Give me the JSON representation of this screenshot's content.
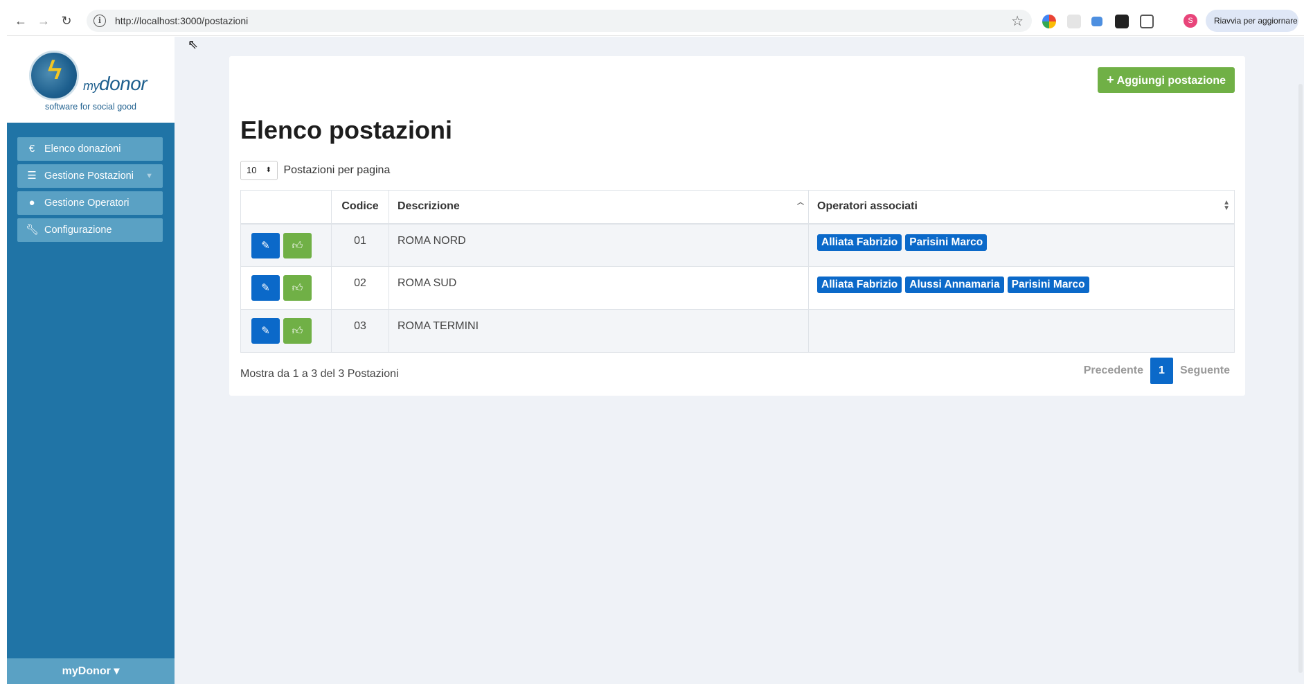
{
  "browser": {
    "url": "http://localhost:3000/postazioni",
    "update_label": "Riavvia per aggiornare",
    "profile_initial": "S"
  },
  "sidebar": {
    "logo": {
      "brand_my": "my",
      "brand_donor": "donor",
      "tagline": "software for social good"
    },
    "items": [
      {
        "label": "Elenco donazioni",
        "icon": "euro-icon"
      },
      {
        "label": "Gestione Postazioni",
        "icon": "list-icon"
      },
      {
        "label": "Gestione Operatori",
        "icon": "user-icon"
      },
      {
        "label": "Configurazione",
        "icon": "wrench-icon"
      }
    ],
    "footer_label": "myDonor ▾"
  },
  "main": {
    "add_button_label": "Aggiungi postazione",
    "title": "Elenco postazioni",
    "per_page_value": "10",
    "per_page_label": "Postazioni per pagina",
    "table": {
      "headers": [
        "",
        "Codice",
        "Descrizione",
        "Operatori associati"
      ],
      "rows": [
        {
          "code": "01",
          "description": "ROMA NORD",
          "operators": [
            "Alliata Fabrizio",
            "Parisini Marco"
          ]
        },
        {
          "code": "02",
          "description": "ROMA SUD",
          "operators": [
            "Alliata Fabrizio",
            "Alussi Annamaria",
            "Parisini Marco"
          ]
        },
        {
          "code": "03",
          "description": "ROMA TERMINI",
          "operators": []
        }
      ]
    },
    "info": "Mostra da 1 a 3 del 3 Postazioni",
    "pagination": {
      "prev": "Precedente",
      "current": "1",
      "next": "Seguente"
    }
  },
  "colors": {
    "sidebar": "#2074a6",
    "menu_item": "#5aa1c4",
    "primary": "#0b69c9",
    "success": "#70b046"
  }
}
